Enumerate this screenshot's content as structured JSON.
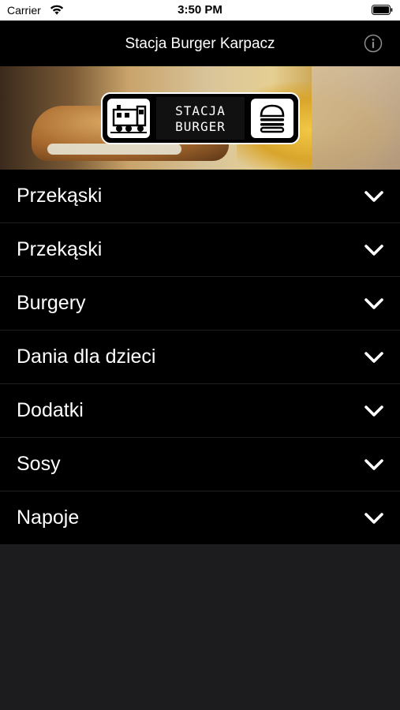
{
  "status_bar": {
    "carrier": "Carrier",
    "time": "3:50 PM"
  },
  "nav": {
    "title": "Stacja Burger Karpacz"
  },
  "logo": {
    "line1": "STACJA",
    "line2": "BURGER"
  },
  "menu": {
    "items": [
      {
        "label": "Przekąski"
      },
      {
        "label": "Przekąski"
      },
      {
        "label": "Burgery"
      },
      {
        "label": "Dania dla dzieci"
      },
      {
        "label": "Dodatki"
      },
      {
        "label": "Sosy"
      },
      {
        "label": "Napoje"
      }
    ]
  },
  "icons": {
    "wifi": "wifi-icon",
    "battery": "battery-icon",
    "info": "info-icon",
    "train": "train-icon",
    "burger": "burger-icon",
    "chevron": "chevron-down-icon"
  },
  "colors": {
    "background": "#1c1c1e",
    "row": "#000000",
    "text": "#ffffff",
    "status_bar": "#ffffff"
  }
}
